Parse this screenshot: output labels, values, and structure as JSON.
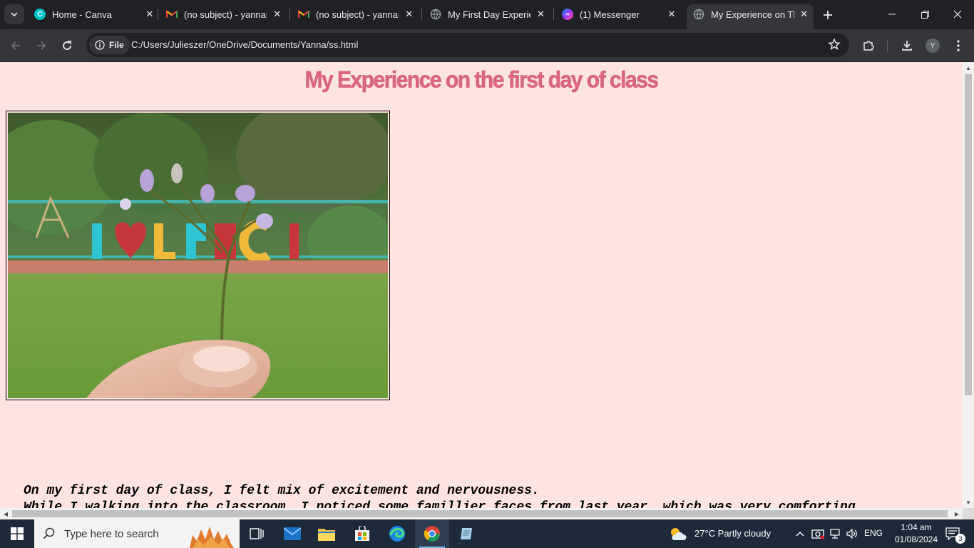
{
  "browser": {
    "tabs": [
      {
        "title": "Home - Canva",
        "icon": "canva-icon",
        "color": "#00c4cc",
        "active": false
      },
      {
        "title": "(no subject) - yannamarie",
        "icon": "gmail-icon",
        "color": "#ea4335",
        "active": false
      },
      {
        "title": "(no subject) - yannamarie",
        "icon": "gmail-icon",
        "color": "#ea4335",
        "active": false
      },
      {
        "title": "My First Day Experience",
        "icon": "globe-icon",
        "color": "#9aa0a6",
        "active": false
      },
      {
        "title": "(1) Messenger",
        "icon": "messenger-icon",
        "color": "#a033ff",
        "active": false
      },
      {
        "title": "My Experience on The First Day",
        "icon": "globe-icon",
        "color": "#9aa0a6",
        "active": true
      }
    ],
    "address_chip": "File",
    "url": "C:/Users/Julieszer/OneDrive/Documents/Yanna/ss.html",
    "profile_initial": "Y"
  },
  "page": {
    "heading": "My Experience on the first day of class",
    "paragraph_line1": "On my first day of class, I felt mix of excitement and nervousness.",
    "paragraph_line2": "While I walking into the classroom, I noticed some famillier faces from last year, which was very comforting."
  },
  "taskbar": {
    "search_placeholder": "Type here to search",
    "weather": "27°C  Partly cloudy",
    "language": "ENG",
    "time": "1:04 am",
    "date": "01/08/2024",
    "notification_count": "3"
  },
  "colors": {
    "page_bg": "#ffe4e1",
    "heading": "#d9677e",
    "chrome_dark": "#202124",
    "chrome_toolbar": "#35363a"
  }
}
